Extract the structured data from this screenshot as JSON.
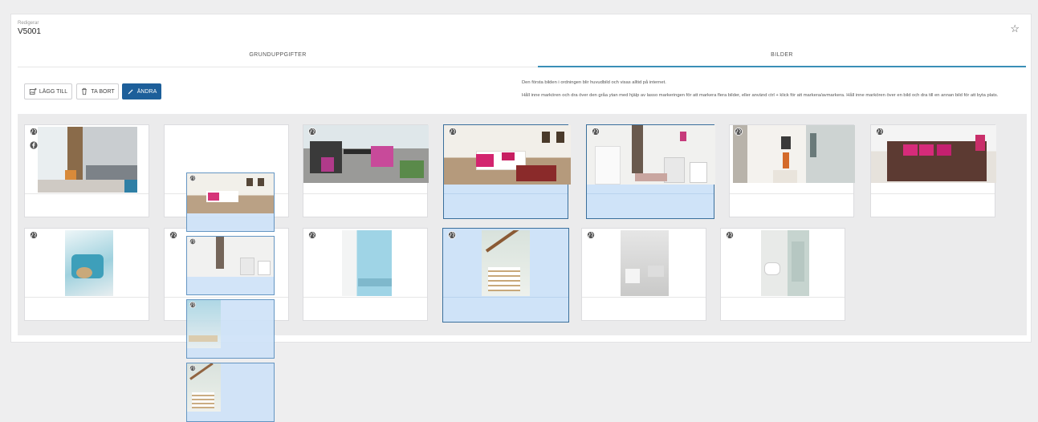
{
  "header": {
    "subtitle": "Redigerar",
    "record_id": "V5001"
  },
  "tabs": [
    {
      "label": "GRUNDUPPGIFTER",
      "active": false
    },
    {
      "label": "BILDER",
      "active": true
    }
  ],
  "toolbar": {
    "add_label": "LÄGG TILL",
    "remove_label": "TA BORT",
    "edit_label": "ÄNDRA"
  },
  "help": {
    "line1": "Den första bilden i ordningen blir huvudbild och visas alltid på internet.",
    "line2": "Håll inne markören och dra över den gråa ytan med hjälp av lasso markeringen för att markera flera bilder, eller använd ctrl + klick för att markera/avmarkera. Håll inne markören över en bild och dra till en annan bild för att byta plats."
  },
  "colors": {
    "accent": "#3a8fb7",
    "primary_button": "#1d5f9a",
    "selected": "#cfe3f8",
    "grid_bg": "#ebebec"
  },
  "icons": [
    "add-image-icon",
    "trash-icon",
    "pencil-icon",
    "star-icon",
    "globe-icon",
    "facebook-icon"
  ],
  "images": [
    {
      "subject": "office-lobby",
      "selected": false,
      "published_web": true,
      "published_facebook": true
    },
    {
      "subject": "empty-slot",
      "selected": false,
      "published_web": false
    },
    {
      "subject": "balcony",
      "selected": false,
      "published_web": true
    },
    {
      "subject": "living-room",
      "selected": true,
      "published_web": true
    },
    {
      "subject": "bathroom-laundry",
      "selected": true,
      "published_web": true
    },
    {
      "subject": "hallway",
      "selected": false,
      "published_web": true
    },
    {
      "subject": "bedroom",
      "selected": false,
      "published_web": true
    },
    {
      "subject": "decor-vase",
      "selected": false,
      "published_web": true
    },
    {
      "subject": "empty-slot",
      "selected": false,
      "published_web": true
    },
    {
      "subject": "blue-bathroom",
      "selected": false,
      "published_web": true
    },
    {
      "subject": "staircase",
      "selected": true,
      "published_web": true
    },
    {
      "subject": "white-room",
      "selected": false,
      "published_web": true
    },
    {
      "subject": "toilet-shower",
      "selected": false,
      "published_web": true
    }
  ],
  "drag_stack": [
    "living-room",
    "bathroom-laundry",
    "blue-wall",
    "staircase"
  ]
}
